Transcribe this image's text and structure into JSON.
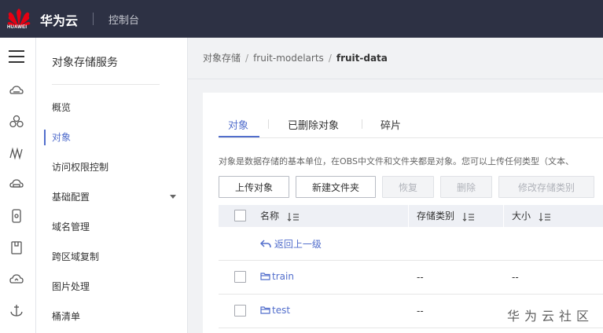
{
  "header": {
    "logo_text": "HUAWEI",
    "brand": "华为云",
    "console": "控制台"
  },
  "rail": {
    "icons": [
      "menu-icon",
      "cloud-server-icon",
      "cluster-icon",
      "network-icon",
      "database-icon",
      "storage-device-icon",
      "mobile-icon",
      "cloud-icon",
      "anchor-icon"
    ]
  },
  "sidenav": {
    "title": "对象存储服务",
    "items": [
      {
        "label": "概览"
      },
      {
        "label": "对象"
      },
      {
        "label": "访问权限控制"
      },
      {
        "label": "基础配置"
      },
      {
        "label": "域名管理"
      },
      {
        "label": "跨区域复制"
      },
      {
        "label": "图片处理"
      },
      {
        "label": "桶清单"
      }
    ]
  },
  "breadcrumb": {
    "items": [
      "对象存储",
      "fruit-modelarts",
      "fruit-data"
    ],
    "separator": "/"
  },
  "tabs": [
    "对象",
    "已删除对象",
    "碎片"
  ],
  "description": "对象是数据存储的基本单位，在OBS中文件和文件夹都是对象。您可以上传任何类型（文本、",
  "toolbar": {
    "upload": "上传对象",
    "new_folder": "新建文件夹",
    "restore": "恢复",
    "delete": "删除",
    "change_storage": "修改存储类别"
  },
  "table": {
    "columns": [
      "名称",
      "存储类别",
      "大小"
    ],
    "back_label": "返回上一级",
    "rows": [
      {
        "name": "train",
        "storage": "--",
        "size": "--"
      },
      {
        "name": "test",
        "storage": "--",
        "size": ""
      }
    ]
  },
  "watermark": "华为云社区",
  "colors": {
    "topbar": "#2d3144",
    "accent": "#526ecc",
    "huawei_red": "#e60012"
  }
}
